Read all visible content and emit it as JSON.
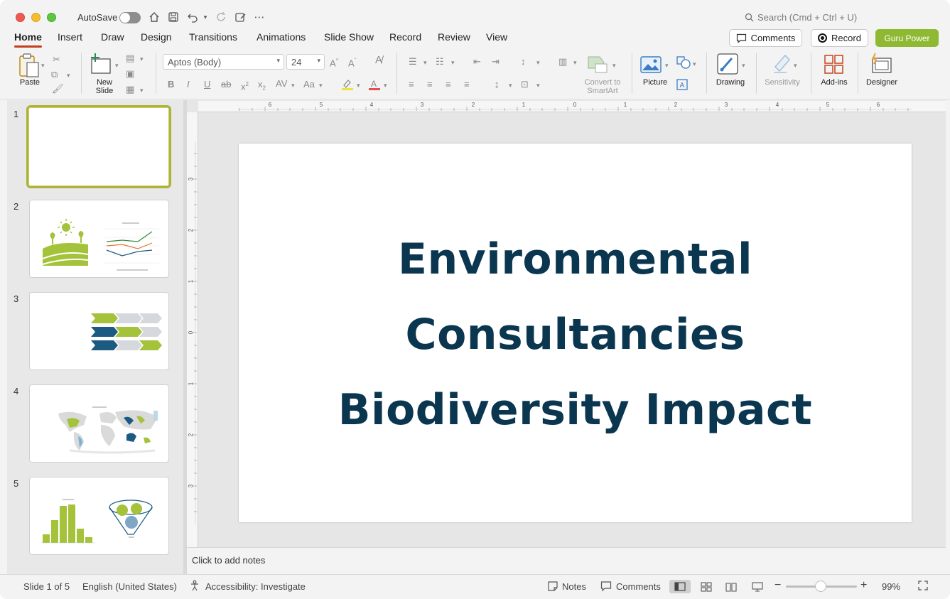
{
  "titlebar": {
    "autosave_label": "AutoSave",
    "search_placeholder": "Search (Cmd + Ctrl + U)"
  },
  "tabs": [
    "Home",
    "Insert",
    "Draw",
    "Design",
    "Transitions",
    "Animations",
    "Slide Show",
    "Record",
    "Review",
    "View"
  ],
  "active_tab": "Home",
  "header_buttons": {
    "comments": "Comments",
    "record": "Record",
    "guru": "Guru Power"
  },
  "ribbon": {
    "paste": "Paste",
    "new_slide_line1": "New",
    "new_slide_line2": "Slide",
    "font_name": "Aptos (Body)",
    "font_size": "24",
    "convert_line1": "Convert to",
    "convert_line2": "SmartArt",
    "picture": "Picture",
    "drawing": "Drawing",
    "sensitivity": "Sensitivity",
    "addins": "Add-ins",
    "designer": "Designer"
  },
  "thumbnails": [
    "1",
    "2",
    "3",
    "4",
    "5"
  ],
  "slide": {
    "title_line1": "Environmental",
    "title_line2": "Consultancies",
    "title_line3": "Biodiversity Impact"
  },
  "notes_placeholder": "Click to add notes",
  "status": {
    "slide_count": "Slide 1 of 5",
    "language": "English (United States)",
    "accessibility": "Accessibility: Investigate",
    "notes": "Notes",
    "comments": "Comments",
    "zoom": "99%"
  },
  "colors": {
    "accent_tab": "#c43e1c",
    "guru": "#8fb833",
    "title_text": "#0b3650",
    "thumb_green": "#a4c23a",
    "thumb_blue": "#1d5a82"
  }
}
